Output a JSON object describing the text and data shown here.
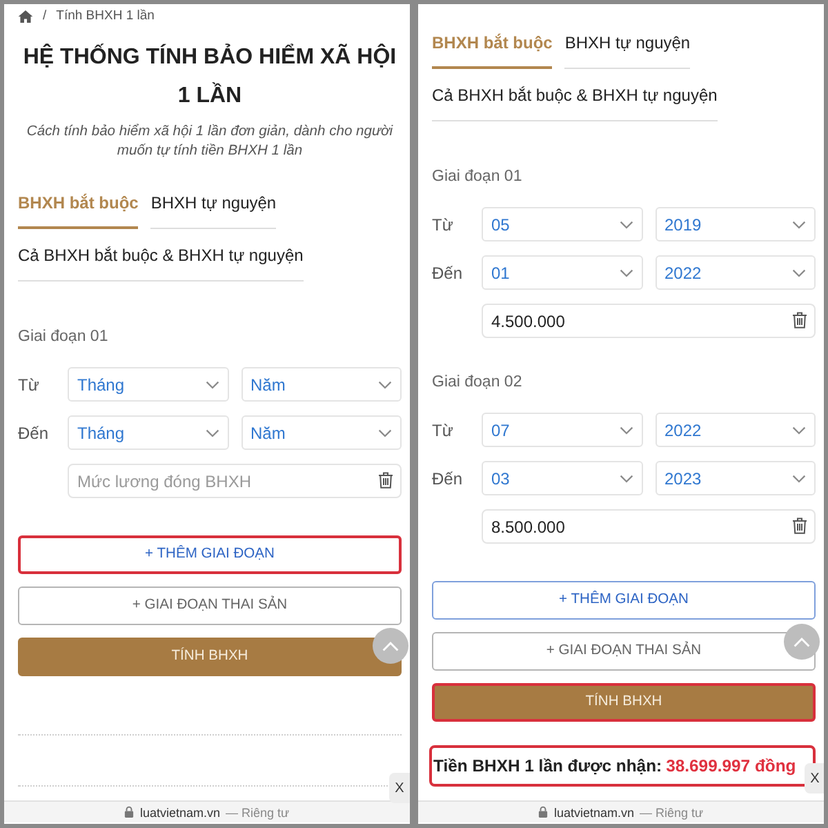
{
  "screens": [
    {
      "breadcrumb": {
        "separator": "/",
        "current": "Tính BHXH 1 lần"
      },
      "title": "HỆ THỐNG TÍNH BẢO HIỂM XÃ HỘI 1 LẦN",
      "subtitle": "Cách tính bảo hiểm xã hội 1 lần đơn giản, dành cho người muốn tự tính tiền BHXH 1 lần",
      "tabs": [
        {
          "label": "BHXH bắt buộc",
          "selected": true
        },
        {
          "label": "BHXH tự nguyện",
          "selected": false
        },
        {
          "label": "Cả BHXH bắt buộc & BHXH tự nguyện",
          "selected": false
        }
      ],
      "periods": [
        {
          "label": "Giai đoạn 01",
          "rows": [
            {
              "label": "Từ",
              "month": "Tháng",
              "year": "Năm"
            },
            {
              "label": "Đến",
              "month": "Tháng",
              "year": "Năm"
            }
          ],
          "salary": {
            "placeholder": "Mức lương đóng BHXH"
          }
        }
      ],
      "buttons": [
        {
          "kind": "add",
          "label": "+ THÊM GIAI ĐOẠN",
          "highlighted": true
        },
        {
          "kind": "secondary",
          "label": "+ GIAI ĐOẠN THAI SẢN",
          "highlighted": false
        },
        {
          "kind": "primary",
          "label": "TÍNH BHXH",
          "highlighted": false
        }
      ],
      "ad_close": "X",
      "footer": {
        "domain": "luatvietnam.vn",
        "label": "— Riêng tư"
      }
    },
    {
      "tabs": [
        {
          "label": "BHXH bắt buộc",
          "selected": true
        },
        {
          "label": "BHXH tự nguyện",
          "selected": false
        },
        {
          "label": "Cả BHXH bắt buộc & BHXH tự nguyện",
          "selected": false
        }
      ],
      "periods": [
        {
          "label": "Giai đoạn 01",
          "rows": [
            {
              "label": "Từ",
              "month": "05",
              "year": "2019"
            },
            {
              "label": "Đến",
              "month": "01",
              "year": "2022"
            }
          ],
          "salary": {
            "value": "4.500.000"
          }
        },
        {
          "label": "Giai đoạn 02",
          "rows": [
            {
              "label": "Từ",
              "month": "07",
              "year": "2022"
            },
            {
              "label": "Đến",
              "month": "03",
              "year": "2023"
            }
          ],
          "salary": {
            "value": "8.500.000"
          }
        }
      ],
      "buttons": [
        {
          "kind": "add",
          "label": "+ THÊM GIAI ĐOẠN",
          "highlighted": false
        },
        {
          "kind": "secondary",
          "label": "+ GIAI ĐOẠN THAI SẢN",
          "highlighted": false
        },
        {
          "kind": "primary",
          "label": "TÍNH BHXH",
          "highlighted": true
        }
      ],
      "result": {
        "label": "Tiền BHXH 1 lần được nhận:",
        "amount": "38.699.997 đồng",
        "highlighted": true
      },
      "ad_close": "X",
      "footer": {
        "domain": "luatvietnam.vn",
        "label": "— Riêng tư"
      }
    }
  ]
}
